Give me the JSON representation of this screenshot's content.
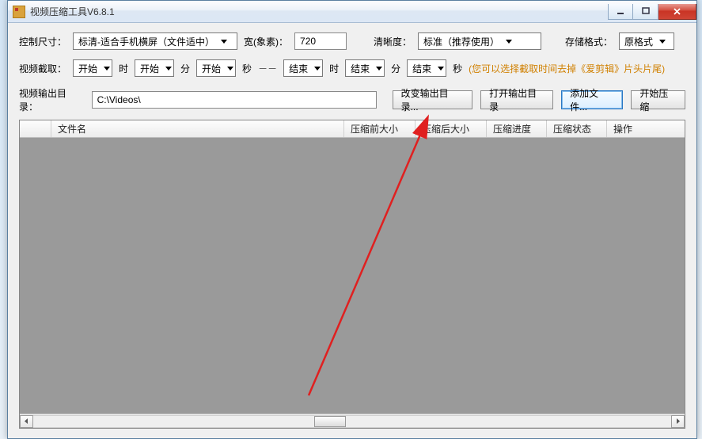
{
  "window": {
    "title": "视频压缩工具V6.8.1"
  },
  "row1": {
    "size_label": "控制尺寸：",
    "size_value": "标清-适合手机横屏（文件适中）",
    "width_label": "宽(象素)：",
    "width_value": "720",
    "clarity_label": "清晰度：",
    "clarity_value": "标准（推荐使用）",
    "format_label": "存储格式：",
    "format_value": "原格式"
  },
  "row2": {
    "trim_label": "视频截取：",
    "start": "开始",
    "end": "结束",
    "hour": "时",
    "min": "分",
    "sec": "秒",
    "dashes": "－－",
    "hint": "(您可以选择截取时间去掉《爱剪辑》片头片尾)"
  },
  "row3": {
    "out_label": "视频输出目录：",
    "out_path": "C:\\Videos\\",
    "btn_change": "改变输出目录...",
    "btn_open": "打开输出目录",
    "btn_add": "添加文件...",
    "btn_start": "开始压缩"
  },
  "columns": {
    "c0": "",
    "c1": "文件名",
    "c2": "压缩前大小",
    "c3": "压缩后大小",
    "c4": "压缩进度",
    "c5": "压缩状态",
    "c6": "操作"
  }
}
